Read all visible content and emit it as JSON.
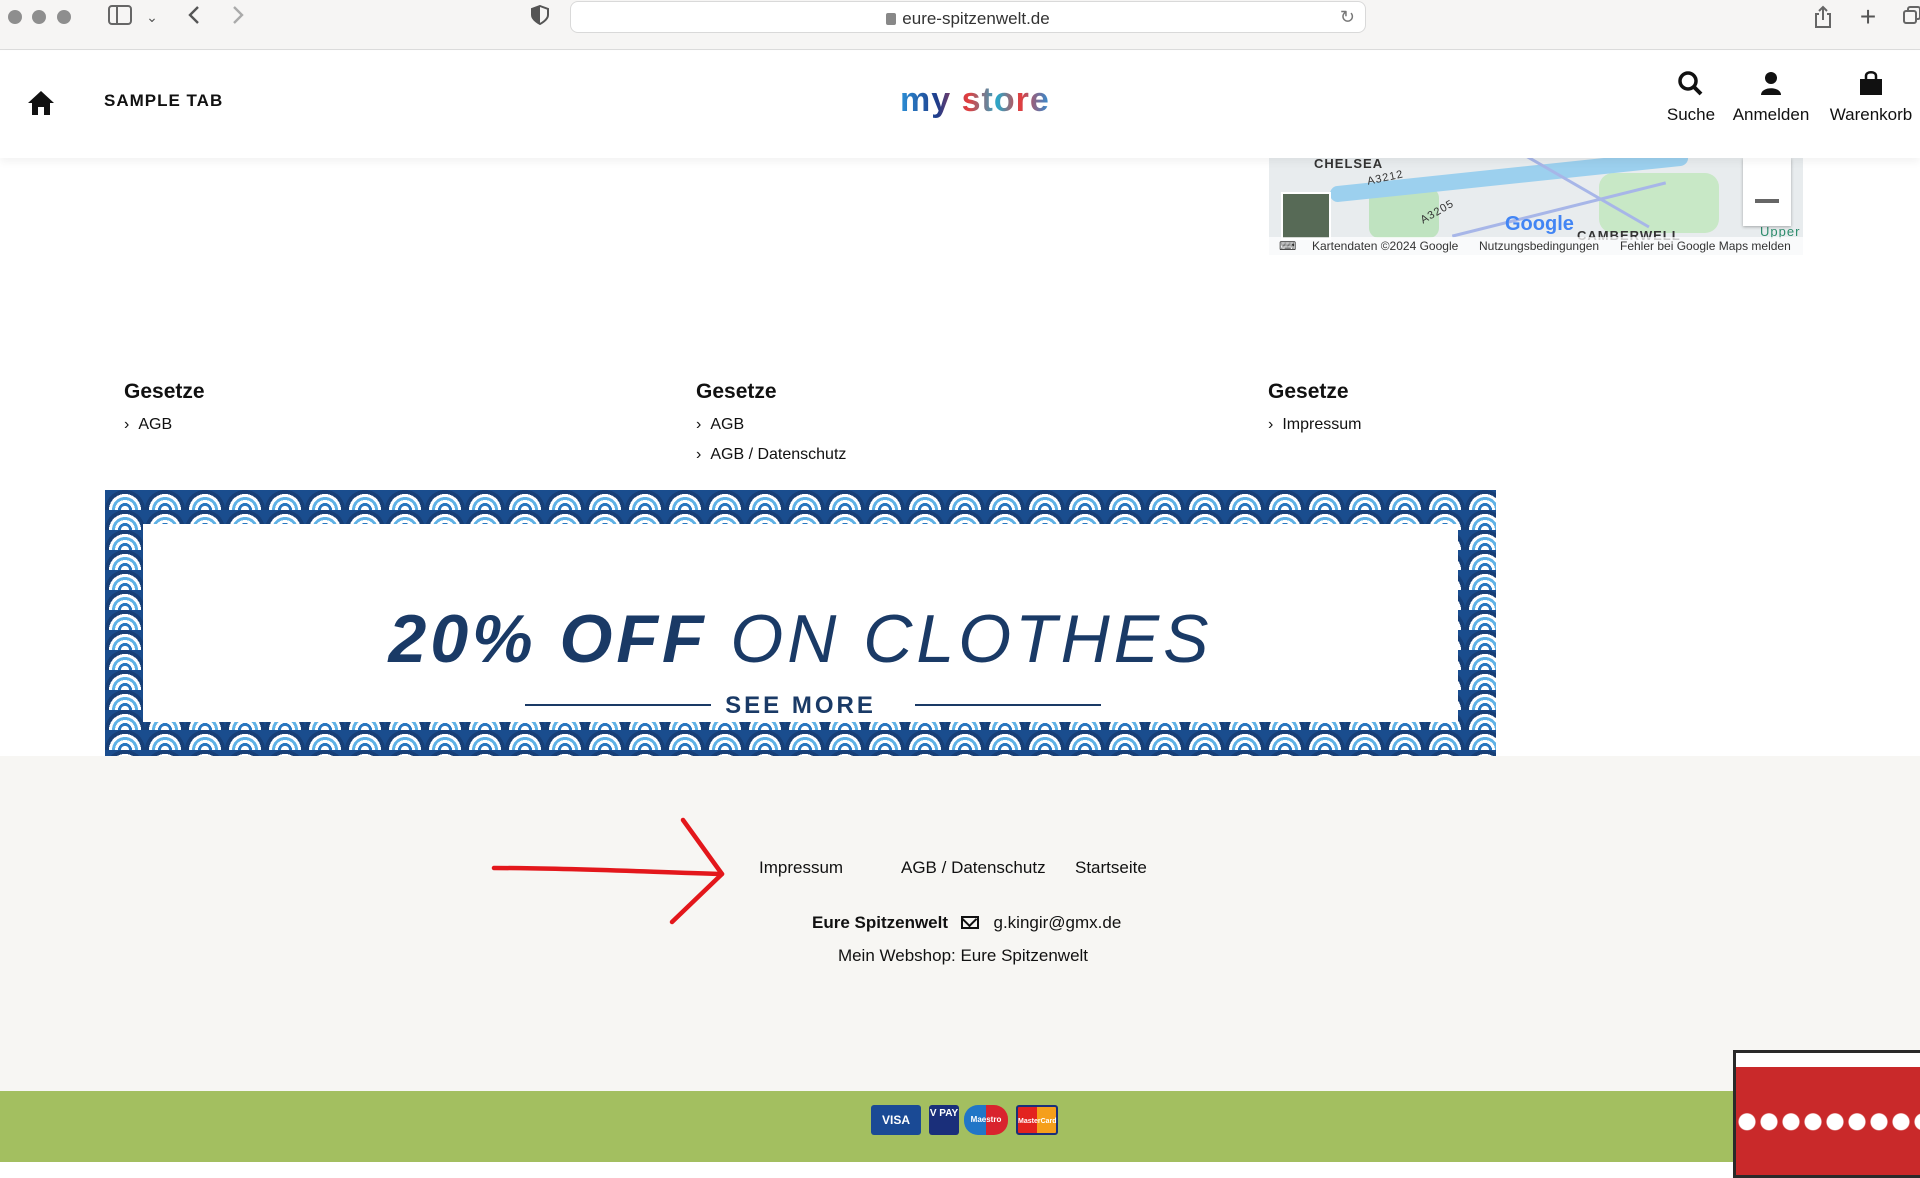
{
  "browser": {
    "url": "eure-spitzenwelt.de",
    "back_icon": "chevron-left-icon",
    "forward_icon": "chevron-right-icon"
  },
  "header": {
    "home_icon": "home-icon",
    "tab_label": "SAMPLE TAB",
    "logo_text": "my store",
    "search_label": "Suche",
    "login_label": "Anmelden",
    "cart_label": "Warenkorb"
  },
  "map": {
    "label_chelsea": "CHELSEA",
    "label_a3212": "A3212",
    "label_a3205": "A3205",
    "label_camberwell": "CAMBERWELL",
    "label_upper": "Upper",
    "google": "Google",
    "attr_data": "Kartendaten ©2024 Google",
    "attr_terms": "Nutzungsbedingungen",
    "attr_report": "Fehler bei Google Maps melden"
  },
  "columns": [
    {
      "title": "Gesetze",
      "links": [
        "AGB"
      ]
    },
    {
      "title": "Gesetze",
      "links": [
        "AGB",
        "AGB / Datenschutz"
      ]
    },
    {
      "title": "Gesetze",
      "links": [
        "Impressum"
      ]
    }
  ],
  "banner": {
    "title_bold": "20% OFF",
    "title_rest": " ON CLOTHES",
    "cta": "SEE MORE"
  },
  "footer": {
    "links": [
      "Impressum",
      "AGB / Datenschutz",
      "Startseite"
    ],
    "shop_name": "Eure Spitzenwelt",
    "email": "g.kingir@gmx.de",
    "tagline": "Mein Webshop: Eure Spitzenwelt"
  },
  "payments": [
    "VISA",
    "V PAY",
    "Maestro",
    "MasterCard"
  ]
}
